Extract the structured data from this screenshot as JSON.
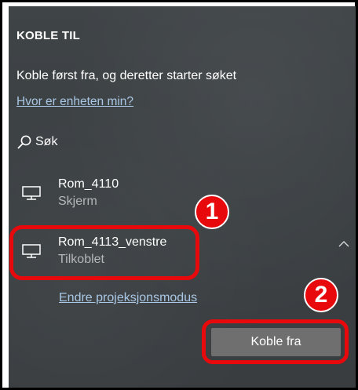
{
  "header": {
    "title": "KOBLE TIL",
    "subtitle": "Koble først fra, og deretter starter søket",
    "where_link": "Hvor er enheten min?"
  },
  "search": {
    "icon": "search-icon",
    "label": "Søk"
  },
  "devices": [
    {
      "icon": "monitor-icon",
      "name": "Rom_4110",
      "status": "Skjerm"
    },
    {
      "icon": "monitor-icon",
      "name": "Rom_4113_venstre",
      "status": "Tilkoblet",
      "expanded": true
    }
  ],
  "connected_device": {
    "mode_link": "Endre projeksjonsmodus",
    "disconnect_label": "Koble fra"
  },
  "annotations": {
    "badge_1": "1",
    "badge_2": "2",
    "color": "#e8090c"
  },
  "colors": {
    "panel_bg": "#3d4144",
    "link": "#a9c7e4",
    "status_text": "#b5b7b8",
    "button_bg": "#6f6f6f"
  }
}
